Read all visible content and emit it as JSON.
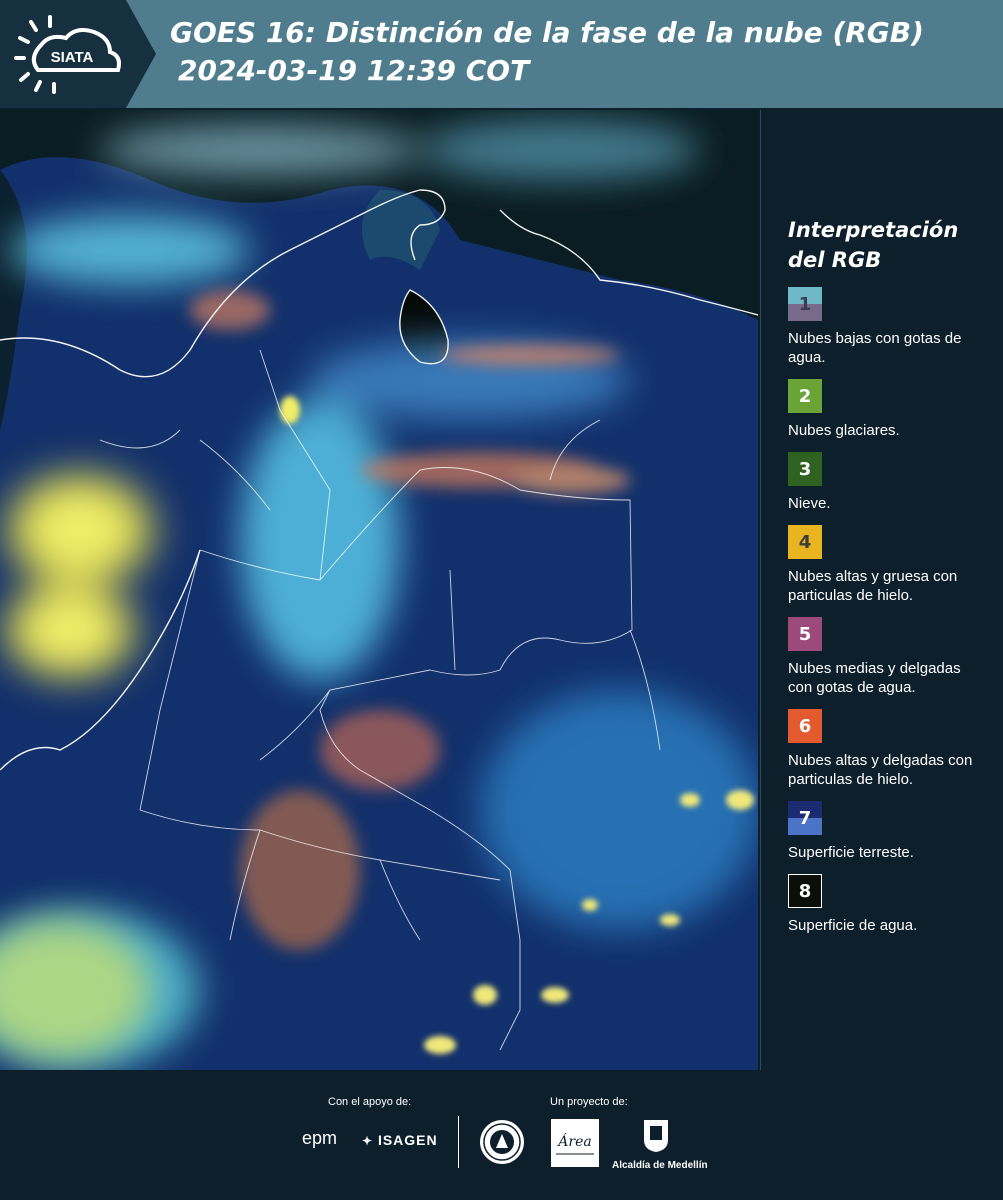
{
  "header": {
    "logo_text": "SIATA",
    "title_line1": "GOES 16: Distinción de la fase de la nube (RGB)",
    "title_line2": "2024-03-19 12:39 COT"
  },
  "legend": {
    "title_line1": "Interpretación",
    "title_line2": "del RGB",
    "items": [
      {
        "number": "1",
        "label": "Nubes bajas con gotas de agua.",
        "color_top": "#6fb8c8",
        "color_bottom": "#7a6a8a"
      },
      {
        "number": "2",
        "label": "Nubes glaciares.",
        "color_top": "#6aa437",
        "color_bottom": "#6aa437"
      },
      {
        "number": "3",
        "label": "Nieve.",
        "color_top": "#2f6120",
        "color_bottom": "#2f6120"
      },
      {
        "number": "4",
        "label": "Nubes altas y gruesa con particulas de hielo.",
        "color_top": "#e8b420",
        "color_bottom": "#e8b420"
      },
      {
        "number": "5",
        "label": "Nubes medias y delgadas con gotas de agua.",
        "color_top": "#9c4a7c",
        "color_bottom": "#9c4a7c"
      },
      {
        "number": "6",
        "label": "Nubes altas y delgadas con particulas de hielo.",
        "color_top": "#e25a2e",
        "color_bottom": "#e25a2e"
      },
      {
        "number": "7",
        "label": "Superficie terreste.",
        "color_top": "#1a2b72",
        "color_bottom": "#4c74c6"
      },
      {
        "number": "8",
        "label": "Superficie de agua.",
        "color_top": "#0a0f0a",
        "color_bottom": "#0a0f0a"
      }
    ]
  },
  "footer": {
    "support_label": "Con el apoyo de:",
    "project_label": "Un proyecto de:",
    "epm_text": "epm",
    "isagen_text": "ISAGEN",
    "area_text": "Área",
    "alcaldia_text": "Alcaldía de Medellín"
  }
}
